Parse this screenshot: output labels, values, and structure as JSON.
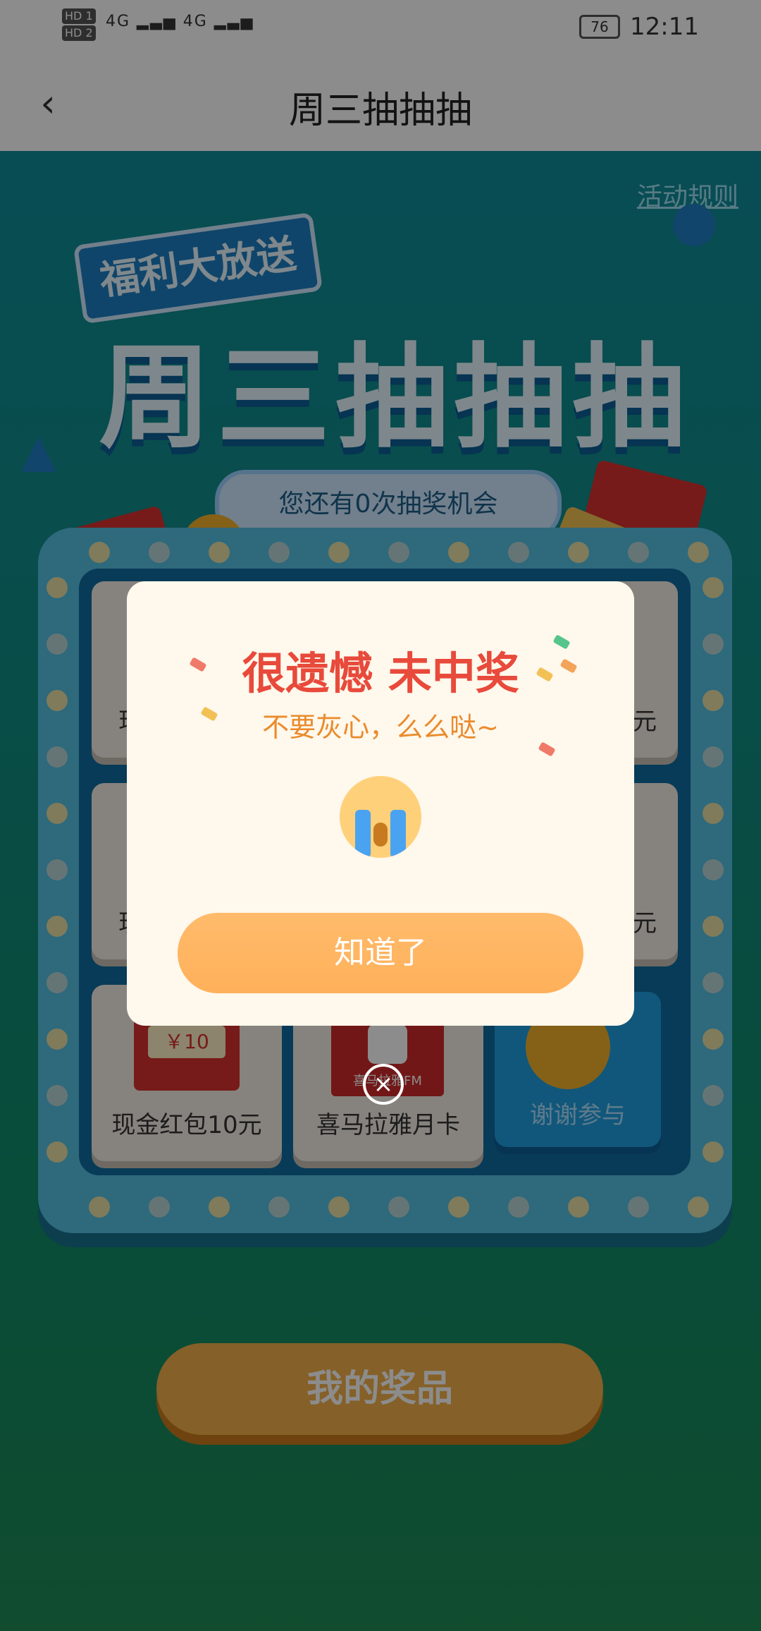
{
  "status_bar": {
    "hd1": "HD 1",
    "hd2": "HD 2",
    "signal": "4G ▂▃▅ 4G ▂▃▅",
    "battery": "76",
    "time": "12:11"
  },
  "header": {
    "back_icon": "‹",
    "title": "周三抽抽抽"
  },
  "scene": {
    "rules_link": "活动规则",
    "promo_tag": "福利大放送",
    "big_title": "周三抽抽抽",
    "chance_text": "您还有0次抽奖机会",
    "cells": [
      {
        "label": "现",
        "type": "partial"
      },
      {
        "label": "8元",
        "type": "partial"
      },
      {
        "label": "现",
        "type": "partial"
      },
      {
        "label": "8元",
        "type": "partial"
      },
      {
        "label": "现金红包10元",
        "type": "cash",
        "amount": "￥10"
      },
      {
        "label": "喜马拉雅月卡",
        "type": "xmly",
        "logo_text": "喜马拉雅FM"
      },
      {
        "label": "谢谢参与",
        "type": "thanks"
      }
    ],
    "my_prizes_button": "我的奖品"
  },
  "modal": {
    "title": "很遗憾 未中奖",
    "subtitle": "不要灰心，么么哒~",
    "ok_button": "知道了",
    "close_icon": "×"
  }
}
